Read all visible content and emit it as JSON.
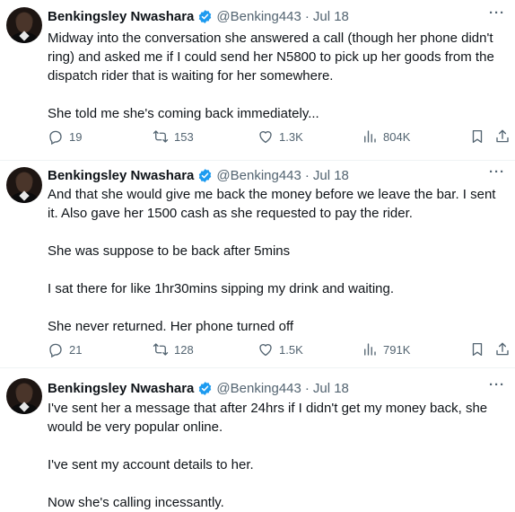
{
  "tweets": [
    {
      "name": "Benkingsley Nwashara",
      "handle": "@Benking443",
      "separator": "·",
      "date": "Jul 18",
      "paragraphs": [
        "Midway into the conversation she answered a call (though her phone didn't ring) and asked me if I could send her N5800 to pick up her goods from the dispatch rider that is waiting for her somewhere.",
        "She told me she's coming back immediately..."
      ],
      "stats": {
        "replies": "19",
        "retweets": "153",
        "likes": "1.3K",
        "views": "804K"
      }
    },
    {
      "name": "Benkingsley Nwashara",
      "handle": "@Benking443",
      "separator": "·",
      "date": "Jul 18",
      "paragraphs": [
        "And that she would give me back the money before we leave the bar. I sent it. Also gave her 1500 cash as she requested to pay the rider.",
        "She was suppose to be back after 5mins",
        "I sat there for like 1hr30mins sipping my drink and waiting.",
        "She never returned. Her phone turned off"
      ],
      "stats": {
        "replies": "21",
        "retweets": "128",
        "likes": "1.5K",
        "views": "791K"
      }
    },
    {
      "name": "Benkingsley Nwashara",
      "handle": "@Benking443",
      "separator": "·",
      "date": "Jul 18",
      "paragraphs": [
        "I've sent her a message that after 24hrs if I didn't get my money back, she would be very popular online.",
        "I've sent my account details to her.",
        "Now she's calling incessantly."
      ]
    }
  ],
  "more_label": "···",
  "icons": {
    "verified": "verified-badge-icon",
    "reply": "reply-icon",
    "retweet": "retweet-icon",
    "like": "heart-icon",
    "views": "views-chart-icon",
    "bookmark": "bookmark-icon",
    "share": "share-icon"
  },
  "colors": {
    "verified": "#1d9bf0",
    "muted": "#536471",
    "text": "#0f1419",
    "divider": "#eff3f4"
  }
}
